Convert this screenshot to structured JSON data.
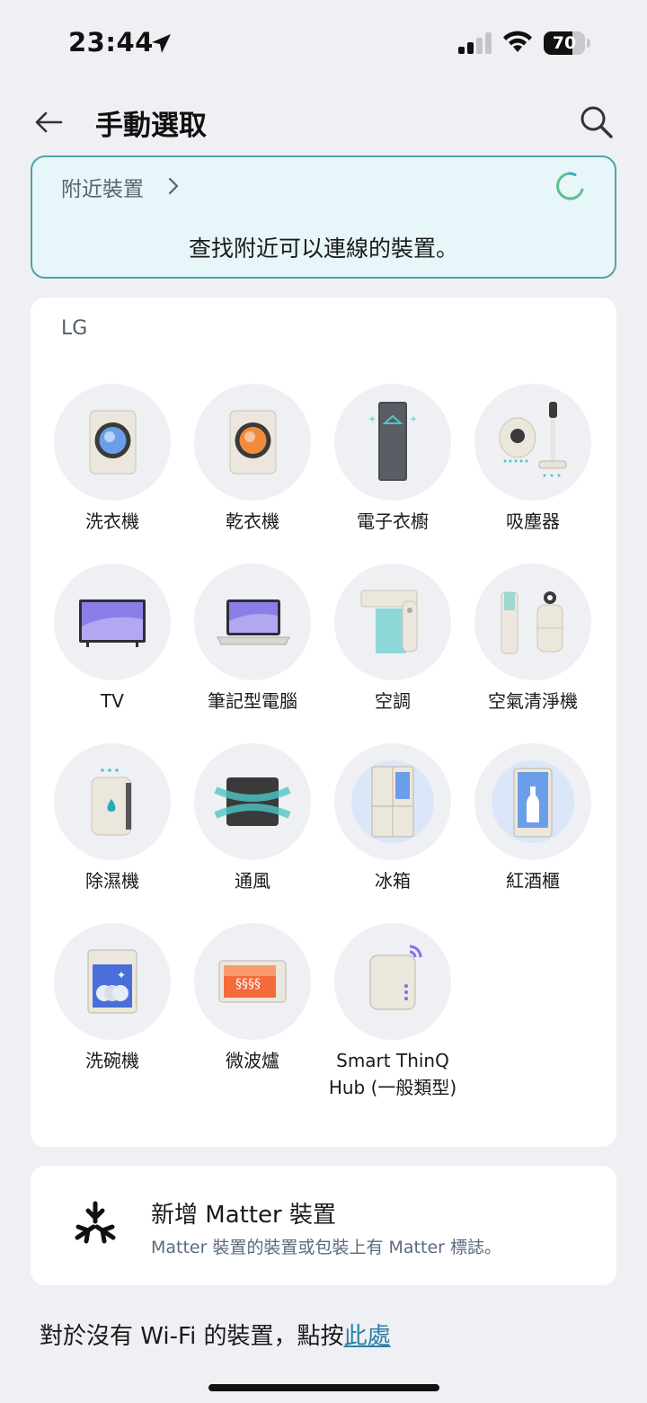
{
  "status_bar": {
    "time": "23:44",
    "battery": "70",
    "battery_level": 0.7,
    "icons": [
      "location-arrow-icon",
      "cellular-signal-icon",
      "wifi-icon",
      "battery-icon"
    ]
  },
  "header": {
    "title": "手動選取",
    "back_icon": "back-arrow-icon",
    "search_icon": "search-icon"
  },
  "nearby": {
    "title": "附近裝置",
    "description": "查找附近可以連線的裝置。",
    "accent": "#4fa3a7"
  },
  "brand_section": {
    "brand": "LG",
    "devices": [
      {
        "label": "洗衣機",
        "icon": "washer-icon"
      },
      {
        "label": "乾衣機",
        "icon": "dryer-icon"
      },
      {
        "label": "電子衣櫥",
        "icon": "styler-icon"
      },
      {
        "label": "吸塵器",
        "icon": "vacuum-icon"
      },
      {
        "label": "TV",
        "icon": "tv-icon"
      },
      {
        "label": "筆記型電腦",
        "icon": "laptop-icon"
      },
      {
        "label": "空調",
        "icon": "air-conditioner-icon"
      },
      {
        "label": "空氣清淨機",
        "icon": "air-purifier-icon"
      },
      {
        "label": "除濕機",
        "icon": "dehumidifier-icon"
      },
      {
        "label": "通風",
        "icon": "ventilation-icon"
      },
      {
        "label": "冰箱",
        "icon": "refrigerator-icon"
      },
      {
        "label": "紅酒櫃",
        "icon": "wine-cellar-icon"
      },
      {
        "label": "洗碗機",
        "icon": "dishwasher-icon"
      },
      {
        "label": "微波爐",
        "icon": "microwave-icon"
      },
      {
        "label": "Smart ThinQ Hub (一般類型)",
        "icon": "thinq-hub-icon"
      }
    ]
  },
  "matter": {
    "title": "新增 Matter 裝置",
    "subtitle": "Matter 裝置的裝置或包裝上有 Matter 標誌。",
    "icon": "matter-logo-icon"
  },
  "footer": {
    "note": "對於沒有 Wi-Fi 的裝置，點按",
    "link": "此處",
    "link_color": "#2d7fa6"
  }
}
